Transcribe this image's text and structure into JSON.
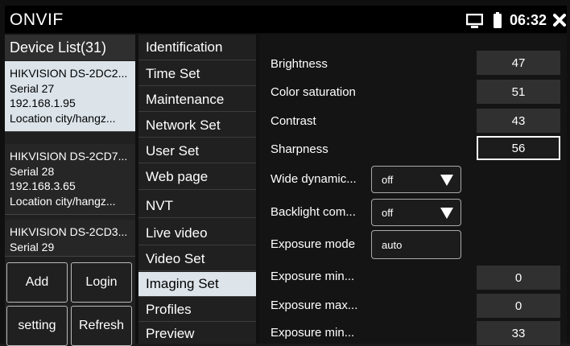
{
  "titlebar": {
    "title": "ONVIF",
    "time": "06:32"
  },
  "device_list": {
    "header": "Device List(31)",
    "devices": [
      {
        "name": "HIKVISION DS-2DC2...",
        "serial": "Serial 27",
        "ip": "192.168.1.95",
        "location": "Location  city/hangz..."
      },
      {
        "name": "HIKVISION DS-2CD7...",
        "serial": "Serial 28",
        "ip": "192.168.3.65",
        "location": "Location  city/hangz..."
      },
      {
        "name": "HIKVISION DS-2CD3...",
        "serial": "Serial 29"
      }
    ],
    "buttons": {
      "add": "Add",
      "login": "Login",
      "setting": "setting",
      "refresh": "Refresh"
    }
  },
  "menu": {
    "items": [
      {
        "label": "Identification"
      },
      {
        "label": "Time Set"
      },
      {
        "label": "Maintenance"
      },
      {
        "label": "Network Set"
      },
      {
        "label": "User Set"
      },
      {
        "label": "Web page"
      },
      {
        "label": "NVT"
      },
      {
        "label": "Live video"
      },
      {
        "label": "Video Set"
      },
      {
        "label": "Imaging Set"
      },
      {
        "label": "Profiles"
      },
      {
        "label": "Preview"
      }
    ],
    "active": "Imaging Set"
  },
  "imaging": {
    "brightness": {
      "label": "Brightness",
      "value": "47"
    },
    "color_saturation": {
      "label": "Color saturation",
      "value": "51"
    },
    "contrast": {
      "label": "Contrast",
      "value": "43"
    },
    "sharpness": {
      "label": "Sharpness",
      "value": "56"
    },
    "wide_dynamic": {
      "label": "Wide dynamic...",
      "value": "off"
    },
    "backlight": {
      "label": "Backlight com...",
      "value": "off"
    },
    "exposure_mode": {
      "label": "Exposure mode",
      "value": "auto"
    },
    "exposure_min_1": {
      "label": "Exposure min...",
      "value": "0"
    },
    "exposure_max": {
      "label": "Exposure max...",
      "value": "0"
    },
    "exposure_min_2": {
      "label": "Exposure min...",
      "value": "33"
    }
  }
}
